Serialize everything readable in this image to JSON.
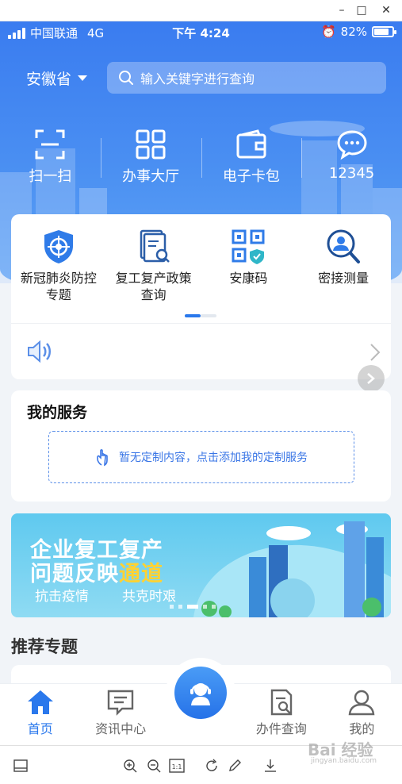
{
  "window": {
    "controls": [
      "minimize-icon",
      "maximize-icon",
      "close-icon"
    ]
  },
  "status_bar": {
    "carrier": "中国联通",
    "network": "4G",
    "time": "下午 4:24",
    "battery": "82%",
    "battery_level": 0.82
  },
  "header": {
    "region": "安徽省",
    "search_placeholder": "输入关键字进行查询"
  },
  "quick_actions": [
    {
      "label": "扫一扫",
      "icon": "scan-icon"
    },
    {
      "label": "办事大厅",
      "icon": "grid-icon"
    },
    {
      "label": "电子卡包",
      "icon": "wallet-icon"
    },
    {
      "label": "12345",
      "icon": "chat-icon"
    }
  ],
  "services": [
    {
      "label": "新冠肺炎防控\n专题",
      "line1": "新冠肺炎防控",
      "line2": "专题",
      "icon": "shield-target-icon"
    },
    {
      "label": "复工复产政策\n查询",
      "line1": "复工复产政策",
      "line2": "查询",
      "icon": "document-search-icon"
    },
    {
      "label": "安康码",
      "line1": "安康码",
      "line2": "",
      "icon": "qr-code-icon"
    },
    {
      "label": "密接测量",
      "line1": "密接测量",
      "line2": "",
      "icon": "person-search-icon"
    }
  ],
  "my_services": {
    "title": "我的服务",
    "empty_text": "暂无定制内容，点击添加我的定制服务"
  },
  "banner": {
    "line1": "企业复工复产",
    "line2_a": "问题反映",
    "line2_b": "通道",
    "sub1": "抗击疫情",
    "sub2": "共克时艰"
  },
  "recommended": {
    "title": "推荐专题"
  },
  "tabs": [
    {
      "label": "首页",
      "icon": "home-icon",
      "active": true
    },
    {
      "label": "资讯中心",
      "icon": "news-icon",
      "active": false
    },
    {
      "label": "",
      "icon": "assistant-icon",
      "active": false
    },
    {
      "label": "办件查询",
      "icon": "query-icon",
      "active": false
    },
    {
      "label": "我的",
      "icon": "user-icon",
      "active": false
    }
  ],
  "watermark": {
    "text": "Bai 经验",
    "sub": "jingyan.baidu.com"
  },
  "colors": {
    "primary": "#2a78ec",
    "header_blue": "#3a7cf0",
    "banner": "#5fc9ef",
    "highlight": "#ffd233"
  }
}
